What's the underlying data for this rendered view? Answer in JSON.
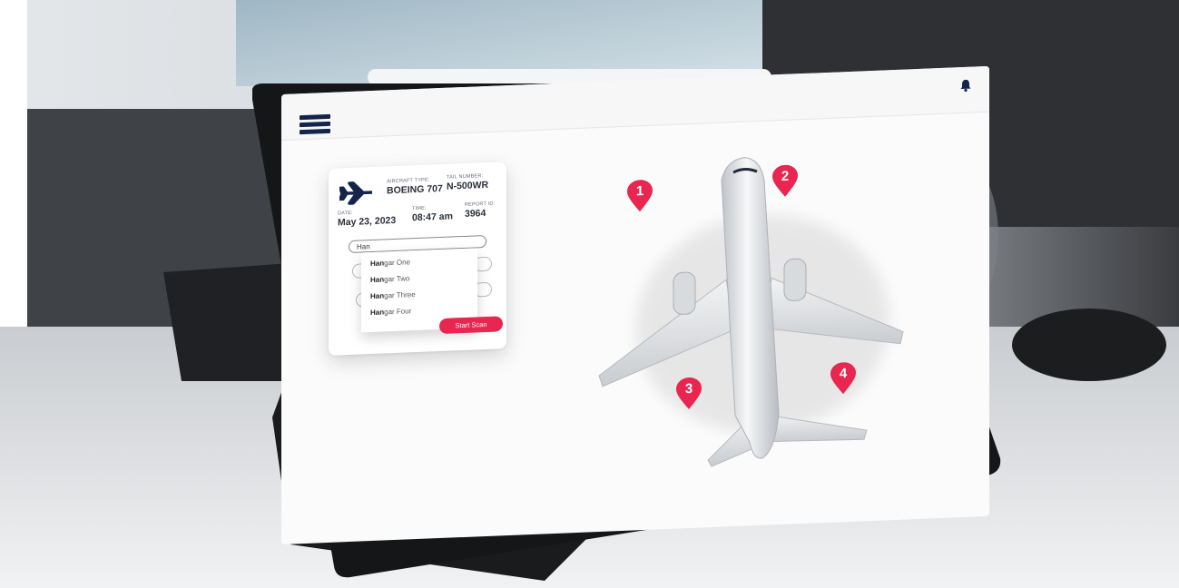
{
  "theme": {
    "accent": "#e8264f",
    "navy": "#14244a"
  },
  "header": {
    "menu_icon": "hamburger-menu-icon",
    "notification_icon": "bell-icon"
  },
  "card": {
    "aircraft_type_label": "AIRCRAFT TYPE:",
    "aircraft_type": "BOEING 707",
    "tail_number_label": "TAIL NUMBER:",
    "tail_number": "N-500WR",
    "date_label": "DATE:",
    "date": "May 23, 2023",
    "time_label": "TIME:",
    "time": "08:47 am",
    "report_id_label": "REPORT ID:",
    "report_id": "3964",
    "search_value": "Han",
    "suggestions": [
      {
        "match": "Han",
        "rest": "gar One"
      },
      {
        "match": "Han",
        "rest": "gar Two"
      },
      {
        "match": "Han",
        "rest": "gar Three"
      },
      {
        "match": "Han",
        "rest": "gar Four"
      }
    ],
    "start_button": "Start Scan"
  },
  "markers": [
    "1",
    "2",
    "3",
    "4"
  ]
}
